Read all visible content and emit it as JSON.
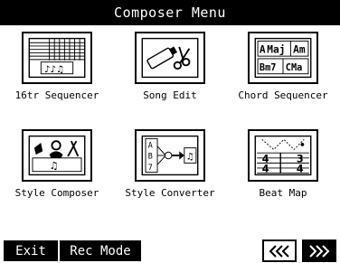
{
  "title": "Composer Menu",
  "menu": {
    "items": [
      {
        "label": "16tr Sequencer",
        "icon": "sequencer-16tr-icon"
      },
      {
        "label": "Song Edit",
        "icon": "song-edit-icon"
      },
      {
        "label": "Chord Sequencer",
        "icon": "chord-sequencer-icon"
      },
      {
        "label": "Style Composer",
        "icon": "style-composer-icon"
      },
      {
        "label": "Style Converter",
        "icon": "style-converter-icon"
      },
      {
        "label": "Beat Map",
        "icon": "beat-map-icon"
      }
    ]
  },
  "chord_icon": {
    "c1": "A",
    "c2": "Maj",
    "c3": "Am",
    "c4": "Bm7",
    "c5": "CMa"
  },
  "converter_icon": {
    "n1": "A",
    "n2": "B",
    "n3": "7"
  },
  "beat_icon": {
    "t1": "4",
    "t2": "4",
    "t3": "3",
    "t4": "4"
  },
  "bottom": {
    "exit_label": "Exit",
    "rec_mode_label": "Rec Mode",
    "prev_icon": "double-chevron-left-icon",
    "next_icon": "double-chevron-right-icon"
  },
  "colors": {
    "background": "#ffffff",
    "foreground": "#000000"
  }
}
